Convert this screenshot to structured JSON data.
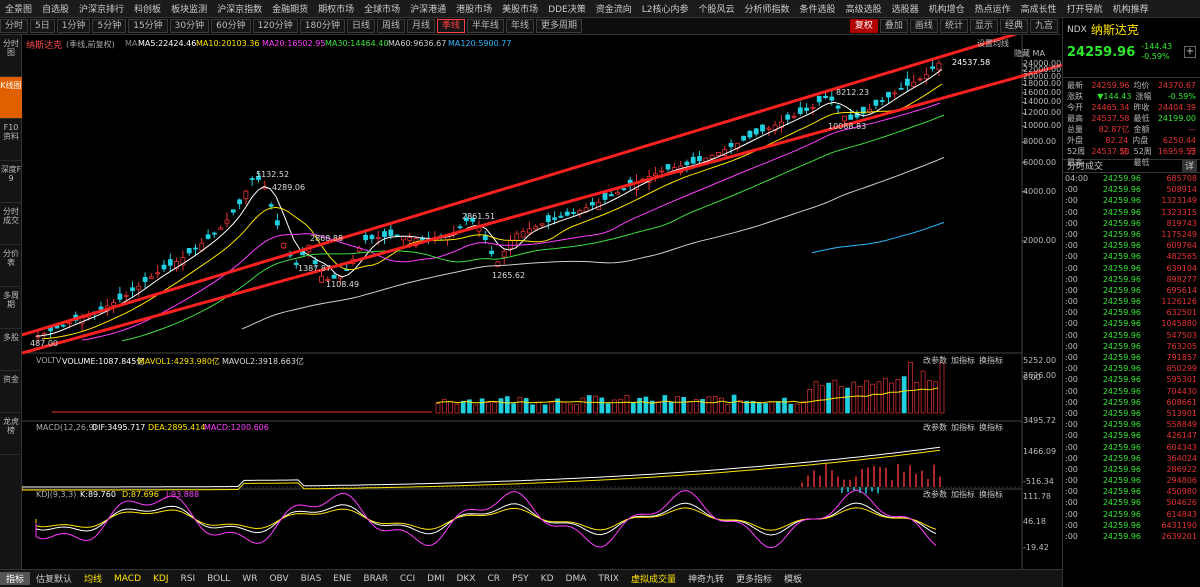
{
  "top_menu": [
    "全景图",
    "自选股",
    "沪深京排行",
    "科创板",
    "板块监测",
    "沪深京指数",
    "金融期货",
    "期权市场",
    "全球市场",
    "沪深港通",
    "港股市场",
    "美股市场",
    "DDE决策",
    "资金流向",
    "L2核心内参",
    "个股风云",
    "分析师指数",
    "条件选股",
    "高级选股",
    "选股器",
    "机构增仓",
    "热点运作",
    "高成长性",
    "打开导航",
    "机构推荐"
  ],
  "timeframes": [
    "分时",
    "5日",
    "1分钟",
    "5分钟",
    "15分钟",
    "30分钟",
    "60分钟",
    "120分钟",
    "180分钟",
    "日线",
    "周线",
    "月线",
    "季线",
    "半年线",
    "年线",
    "更多周期"
  ],
  "active_timeframe": "季线",
  "right_tools": [
    "复权",
    "叠加",
    "画线",
    "统计",
    "显示",
    "经典",
    "九宫"
  ],
  "left_nav": [
    "分时图",
    "K线图",
    "F10资料",
    "深度F9",
    "分时成交",
    "分价表",
    "多周期",
    "多股",
    "资金",
    "龙虎榜"
  ],
  "active_left_nav": "K线图",
  "chart_title": "纳斯达克",
  "chart_subtitle": "(季线,前复权)",
  "ma": [
    "MA5:22424.46",
    "MA10:20103.36",
    "MA20:16502.95",
    "MA30:14464.40",
    "MA60:9636.67",
    "MA120:5900.77"
  ],
  "settings_label": "设置均线",
  "hide_label": "隐藏 MA",
  "price_labels": {
    "high": "24537.58",
    "l5132": "5132.52",
    "l4289": "4289.06",
    "l2861": "2861.51",
    "l2868": "2868.88",
    "l1387": "1387.87",
    "l1108": "1108.49",
    "l1265": "1265.62",
    "l8212": "8212.23",
    "l10088": "10088.83",
    "low": "487.00"
  },
  "y_axis": [
    "24000.00",
    "22000.00",
    "20000.00",
    "18000.00",
    "16000.00",
    "14000.00",
    "12000.00",
    "10000.00",
    "8000.00",
    "6000.00",
    "4000.00",
    "2000.00"
  ],
  "volume": {
    "label": "VOLTV",
    "vol_text": "VOLUME:1087.845亿",
    "mavol1": "MAVOL1:4293.980亿",
    "mavol2": "MAVOL2:3918.663亿",
    "axis": [
      "5252.00",
      "2626.00",
      "0.00"
    ]
  },
  "macd": {
    "label": "MACD(12,26,9)",
    "dif": "DIF:3495.717",
    "dea": "DEA:2895.414",
    "macd": "MACD:1200.606",
    "axis": [
      "3495.72",
      "1466.09",
      "-516.34"
    ]
  },
  "kdj": {
    "label": "KDJ(9,3,3)",
    "k": "K:89.760",
    "d": "D:87.696",
    "j": "J:93.888",
    "axis": [
      "111.78",
      "46.18",
      "-19.42"
    ]
  },
  "panel_controls": [
    "改参数",
    "加指标",
    "换指标"
  ],
  "quote": {
    "code": "NDX",
    "name": "纳斯达克",
    "price": "24259.96",
    "change": "-144.43",
    "pct": "-0.59%",
    "rows": [
      [
        "最新",
        "24259.96",
        "均价",
        "24370.67"
      ],
      [
        "涨跌",
        "▼144.43",
        "涨幅",
        "-0.59%"
      ],
      [
        "今开",
        "24465.34",
        "昨收",
        "24404.39"
      ],
      [
        "最高",
        "24537.58",
        "最低",
        "24199.00"
      ],
      [
        "总量",
        "82.87亿",
        "金额",
        "—"
      ],
      [
        "外盘",
        "82.24亿",
        "内盘",
        "6250.44万"
      ],
      [
        "52周最高",
        "24537.58",
        "52周最低",
        "16959.53"
      ]
    ]
  },
  "trade_title": "分时成交",
  "trade_detail": "详",
  "trades": [
    [
      "04:00",
      "24259.96",
      "685708"
    ],
    [
      ":00",
      "24259.96",
      "508914"
    ],
    [
      ":00",
      "24259.96",
      "1323149"
    ],
    [
      ":00",
      "24259.96",
      "1323315"
    ],
    [
      ":00",
      "24259.96",
      "819743"
    ],
    [
      ":00",
      "24259.96",
      "1175249"
    ],
    [
      ":00",
      "24259.96",
      "609764"
    ],
    [
      ":00",
      "24259.96",
      "482565"
    ],
    [
      ":00",
      "24259.96",
      "639104"
    ],
    [
      ":00",
      "24259.96",
      "898277"
    ],
    [
      ":00",
      "24259.96",
      "695614"
    ],
    [
      ":00",
      "24259.96",
      "1126126"
    ],
    [
      ":00",
      "24259.96",
      "632501"
    ],
    [
      ":00",
      "24259.96",
      "1045880"
    ],
    [
      ":00",
      "24259.96",
      "547503"
    ],
    [
      ":00",
      "24259.96",
      "763205"
    ],
    [
      ":00",
      "24259.96",
      "791857"
    ],
    [
      ":00",
      "24259.96",
      "850299"
    ],
    [
      ":00",
      "24259.96",
      "595301"
    ],
    [
      ":00",
      "24259.96",
      "704430"
    ],
    [
      ":00",
      "24259.96",
      "608661"
    ],
    [
      ":00",
      "24259.96",
      "513901"
    ],
    [
      ":00",
      "24259.96",
      "558849"
    ],
    [
      ":00",
      "24259.96",
      "426147"
    ],
    [
      ":00",
      "24259.96",
      "604343"
    ],
    [
      ":00",
      "24259.96",
      "364024"
    ],
    [
      ":00",
      "24259.96",
      "286922"
    ],
    [
      ":00",
      "24259.96",
      "294806"
    ],
    [
      ":00",
      "24259.96",
      "450980"
    ],
    [
      ":00",
      "24259.96",
      "504626"
    ],
    [
      ":00",
      "24259.96",
      "614843"
    ],
    [
      ":00",
      "24259.96",
      "6431190"
    ],
    [
      ":00",
      "24259.96",
      "2639201"
    ]
  ],
  "bottom_tabs": [
    "指标",
    "估复默认",
    "均线",
    "MACD",
    "KDJ",
    "RSI",
    "BOLL",
    "WR",
    "OBV",
    "BIAS",
    "ENE",
    "BRAR",
    "CCI",
    "DMI",
    "DKX",
    "CR",
    "PSY",
    "KD",
    "DMA",
    "TRIX",
    "虚拟成交量",
    "神奇九转",
    "更多指标",
    "模板"
  ],
  "colors": {
    "up": "#e83232",
    "down": "#20d0e0",
    "price_green": "#2ee82e",
    "trendline": "#ff2020",
    "accent": "#e06000"
  }
}
